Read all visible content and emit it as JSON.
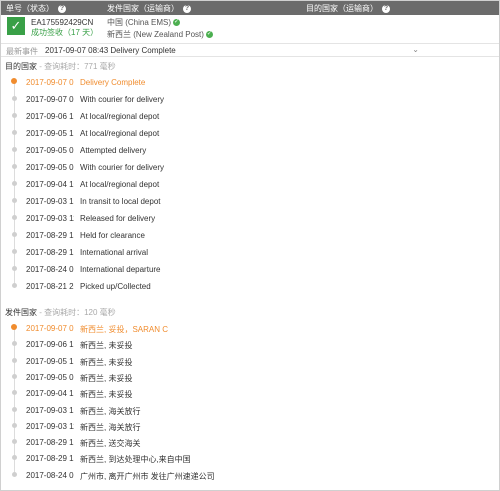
{
  "header": {
    "tracking_no_label": "单号（状态）",
    "origin_label": "发件国家（运输商）",
    "destination_label": "目的国家（运输商）",
    "help_icon": "?"
  },
  "summary": {
    "tracking_number": "EA175592429CN",
    "status": "成功签收（17 天）",
    "origin_carrier": "中国 (China EMS)",
    "destination_carrier": "新西兰 (New Zealand Post)"
  },
  "latest": {
    "label": "最新事件",
    "value": "2017-09-07 08:43 Delivery Complete"
  },
  "destination_section": {
    "title": "目的国家",
    "subtitle": " - 查询耗时：771 毫秒",
    "events": [
      {
        "time": "2017-09-07 08:43",
        "desc": "Delivery Complete",
        "active": true
      },
      {
        "time": "2017-09-07 06:45",
        "desc": "With courier for delivery",
        "active": false
      },
      {
        "time": "2017-09-06 10:20",
        "desc": "At local/regional depot",
        "active": false
      },
      {
        "time": "2017-09-05 16:30",
        "desc": "At local/regional depot",
        "active": false
      },
      {
        "time": "2017-09-05 08:30",
        "desc": "Attempted delivery",
        "active": false
      },
      {
        "time": "2017-09-05 06:45",
        "desc": "With courier for delivery",
        "active": false
      },
      {
        "time": "2017-09-04 10:15",
        "desc": "At local/regional depot",
        "active": false
      },
      {
        "time": "2017-09-03 13:40",
        "desc": "In transit to local depot",
        "active": false
      },
      {
        "time": "2017-09-03 11:20",
        "desc": "Released for delivery",
        "active": false
      },
      {
        "time": "2017-08-29 13:10",
        "desc": "Held for clearance",
        "active": false
      },
      {
        "time": "2017-08-29 13:05",
        "desc": "International arrival",
        "active": false
      },
      {
        "time": "2017-08-24 02:30",
        "desc": "International departure",
        "active": false
      },
      {
        "time": "2017-08-21 20:15",
        "desc": "Picked up/Collected",
        "active": false
      }
    ]
  },
  "origin_section": {
    "title": "发件国家",
    "subtitle": " - 查询耗时：120 毫秒",
    "events": [
      {
        "time": "2017-09-07 08:43",
        "desc": "新西兰, 妥投，SARAN C",
        "active": true
      },
      {
        "time": "2017-09-06 15:10",
        "desc": "新西兰, 未妥投",
        "active": false
      },
      {
        "time": "2017-09-05 16:30",
        "desc": "新西兰, 未妥投",
        "active": false
      },
      {
        "time": "2017-09-05 08:30",
        "desc": "新西兰, 未妥投",
        "active": false
      },
      {
        "time": "2017-09-04 15:20",
        "desc": "新西兰, 未妥投",
        "active": false
      },
      {
        "time": "2017-09-03 13:40",
        "desc": "新西兰, 海关放行",
        "active": false
      },
      {
        "time": "2017-09-03 11:20",
        "desc": "新西兰, 海关放行",
        "active": false
      },
      {
        "time": "2017-08-29 13:10",
        "desc": "新西兰, 送交海关",
        "active": false
      },
      {
        "time": "2017-08-29 13:05",
        "desc": "新西兰, 到达处理中心,来自中国",
        "active": false
      },
      {
        "time": "2017-08-24 02:30",
        "desc": "广州市, 离开广州市 发往广州速递公司",
        "active": false
      }
    ]
  },
  "colors": {
    "header_bg": "#6b6b6b",
    "success_green": "#39a047",
    "highlight_orange": "#f08c2e"
  }
}
